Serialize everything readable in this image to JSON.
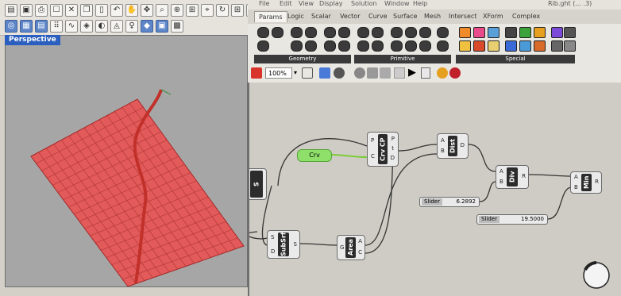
{
  "rhino": {
    "viewport_label": "Perspective",
    "surface_color": "#e35a5a",
    "curve_color": "#c2302a"
  },
  "gh": {
    "menu": [
      "File",
      "Edit",
      "View",
      "Display",
      "Solution",
      "Window",
      "Help"
    ],
    "title_right": "Rib.ght (... .3)",
    "tabs": [
      "Params",
      "Logic",
      "Scalar",
      "Vector",
      "Curve",
      "Surface",
      "Mesh",
      "Intersect",
      "XForm",
      "Complex"
    ],
    "active_tab": "Params",
    "panels": [
      "Geometry",
      "Primitive",
      "Special"
    ],
    "zoom": "100%",
    "components": {
      "crv": "Crv",
      "crv_cp": "Crv CP",
      "dist": "Dist",
      "div": "Div",
      "min": "Min",
      "subsrf": "SubSrf",
      "area": "Area",
      "s_param": "S"
    },
    "ports": {
      "crv_cp_in": [
        "P",
        "C"
      ],
      "crv_cp_out": [
        "P",
        "t",
        "D"
      ],
      "dist_in": [
        "A",
        "B"
      ],
      "dist_out": [
        "D"
      ],
      "div_in": [
        "A",
        "B"
      ],
      "div_out": [
        "R"
      ],
      "min_in": [
        "A",
        "B"
      ],
      "min_out": [
        "R"
      ],
      "subsrf_in": [
        "S",
        "D"
      ],
      "subsrf_out": [
        "S"
      ],
      "area_in": [
        "G"
      ],
      "area_out": [
        "A",
        "C"
      ]
    },
    "sliders": [
      {
        "label": "Slider",
        "value": "6.2892"
      },
      {
        "label": "Slider",
        "value": "19.5000"
      }
    ]
  }
}
